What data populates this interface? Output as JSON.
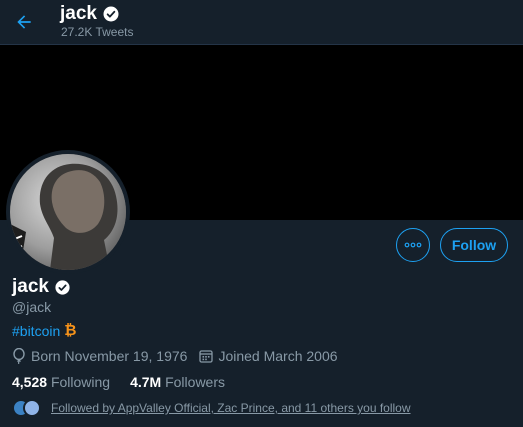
{
  "header": {
    "title": "jack",
    "subtitle": "27.2K Tweets"
  },
  "profile": {
    "name": "jack",
    "handle": "@jack",
    "bio_hashtag": "#bitcoin",
    "bio_symbol": "₿",
    "born": "Born November 19, 1976",
    "joined": "Joined March 2006",
    "following_count": "4,528",
    "following_label": "Following",
    "followers_count": "4.7M",
    "followers_label": "Followers",
    "followed_by": "Followed by AppValley Official, Zac Prince, and 11 others you follow"
  },
  "actions": {
    "follow_label": "Follow",
    "more_icon": "more-icon"
  },
  "colors": {
    "accent": "#1da1f2",
    "background": "#15202b",
    "muted": "#8899a6",
    "bitcoin": "#f7931a"
  }
}
